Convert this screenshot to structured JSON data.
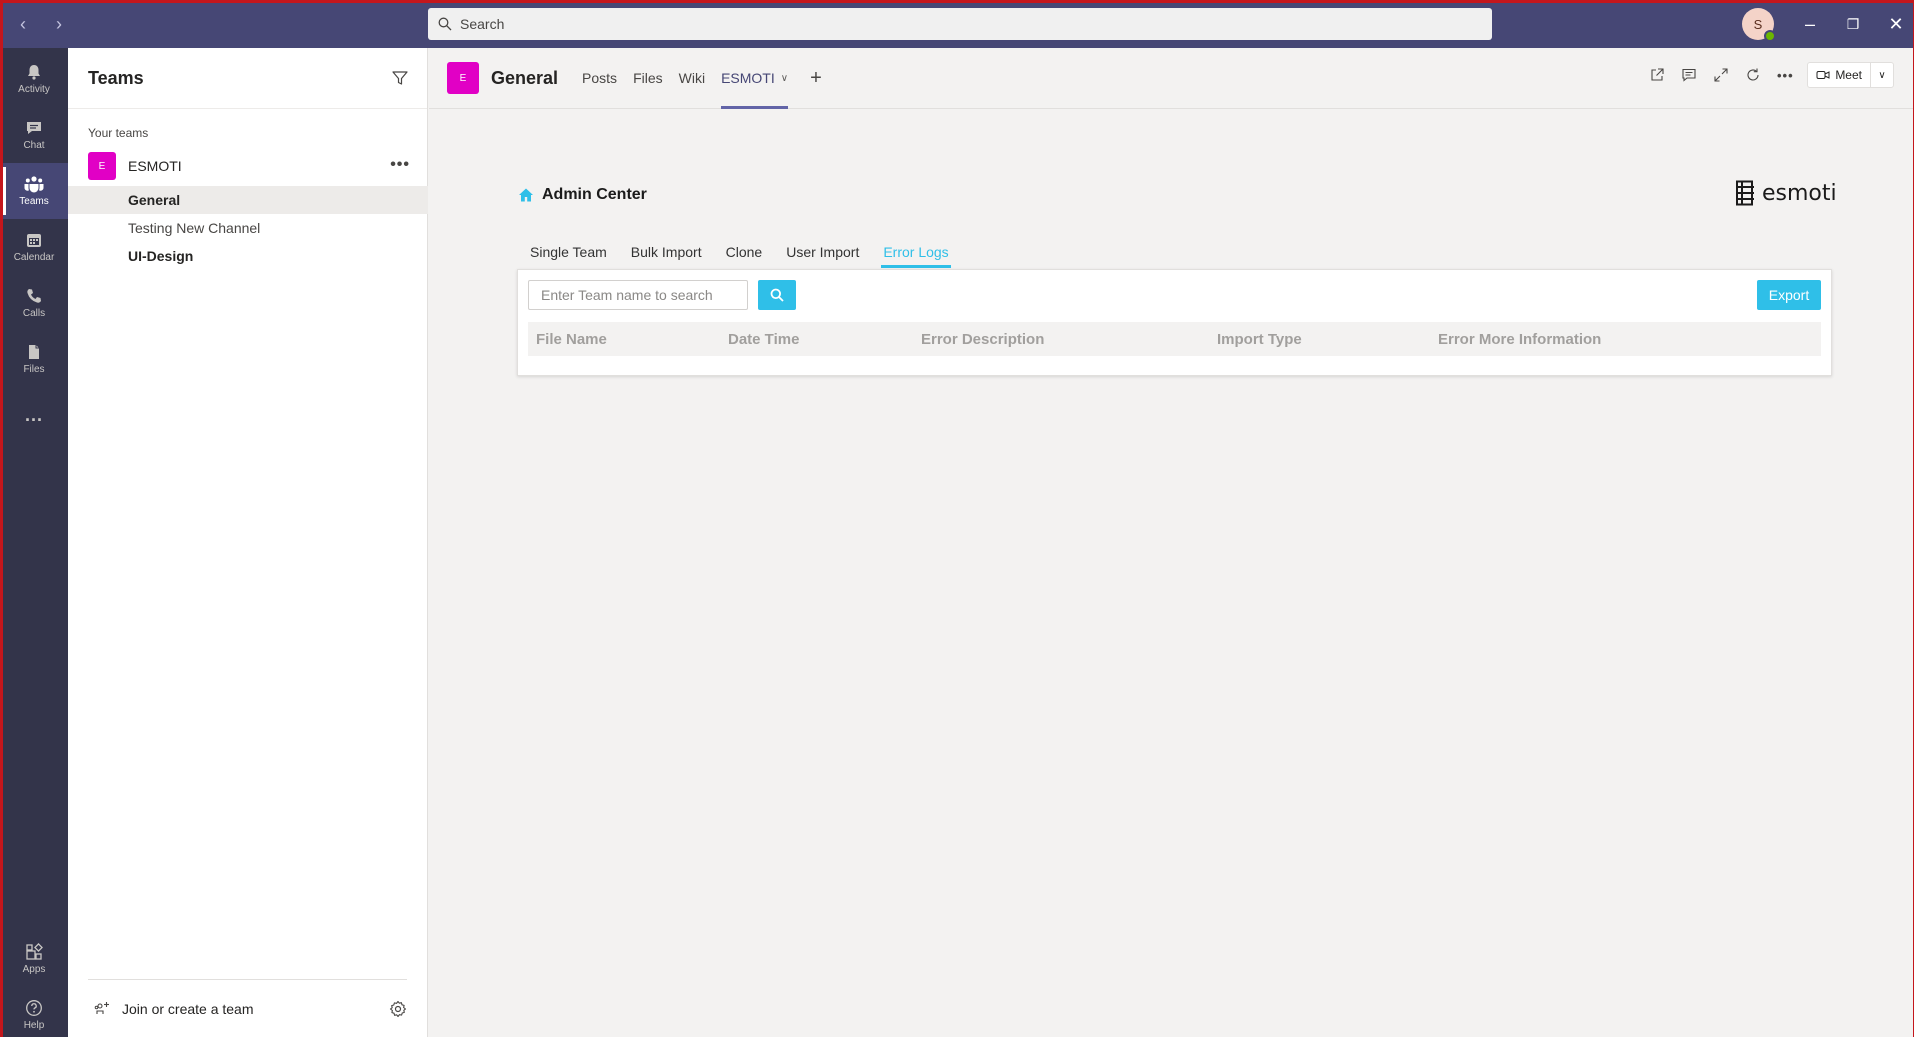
{
  "topbar": {
    "search_placeholder": "Search",
    "avatar_initial": "S"
  },
  "rail": {
    "items": [
      {
        "label": "Activity",
        "icon": "bell-icon"
      },
      {
        "label": "Chat",
        "icon": "chat-icon"
      },
      {
        "label": "Teams",
        "icon": "teams-icon",
        "active": true
      },
      {
        "label": "Calendar",
        "icon": "calendar-icon"
      },
      {
        "label": "Calls",
        "icon": "phone-icon"
      },
      {
        "label": "Files",
        "icon": "file-icon"
      },
      {
        "label": "...",
        "icon": "more-icon"
      }
    ],
    "bottom": [
      {
        "label": "Apps",
        "icon": "apps-icon"
      },
      {
        "label": "Help",
        "icon": "help-icon"
      }
    ]
  },
  "teams_pane": {
    "title": "Teams",
    "section_label": "Your teams",
    "team": {
      "initial": "E",
      "name": "ESMOTI"
    },
    "channels": [
      {
        "name": "General",
        "selected": true
      },
      {
        "name": "Testing New Channel"
      },
      {
        "name": "UI-Design",
        "bold": true
      }
    ],
    "footer": {
      "join_label": "Join or create a team"
    }
  },
  "channel_header": {
    "initial": "E",
    "title": "General",
    "tabs": [
      {
        "label": "Posts"
      },
      {
        "label": "Files"
      },
      {
        "label": "Wiki"
      },
      {
        "label": "ESMOTI",
        "active": true
      }
    ],
    "meet_label": "Meet"
  },
  "admin": {
    "title": "Admin Center",
    "brand": "esmoti",
    "tabs": [
      {
        "label": "Single Team"
      },
      {
        "label": "Bulk Import"
      },
      {
        "label": "Clone"
      },
      {
        "label": "User Import"
      },
      {
        "label": "Error Logs",
        "active": true
      }
    ],
    "search_placeholder": "Enter Team name to search",
    "export_label": "Export",
    "columns": [
      "File Name",
      "Date Time",
      "Error Description",
      "Import Type",
      "Error More Information"
    ]
  },
  "colors": {
    "topbar": "#464775",
    "rail": "#33344a",
    "accent": "#2fbfe8",
    "team_avatar": "#e100c5"
  }
}
